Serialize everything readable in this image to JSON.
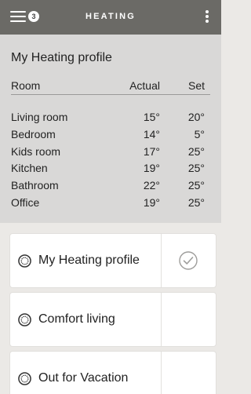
{
  "header": {
    "title": "HEATING",
    "badge_count": "3",
    "menu_icon": "hamburger-menu-icon",
    "more_icon": "more-vertical-icon"
  },
  "summary": {
    "profile_title": "My Heating profile",
    "columns": {
      "room": "Room",
      "actual": "Actual",
      "set": "Set"
    },
    "rows": [
      {
        "room": "Living room",
        "actual": "15",
        "set": "20"
      },
      {
        "room": "Bedroom",
        "actual": "14",
        "set": "5"
      },
      {
        "room": "Kids room",
        "actual": "17",
        "set": "25"
      },
      {
        "room": "Kitchen",
        "actual": "19",
        "set": "25"
      },
      {
        "room": "Bathroom",
        "actual": "22",
        "set": "25"
      },
      {
        "room": "Office",
        "actual": "19",
        "set": "25"
      }
    ],
    "degree_symbol": "°"
  },
  "profiles": [
    {
      "label": "My Heating profile",
      "selected": true
    },
    {
      "label": "Comfort living",
      "selected": false
    },
    {
      "label": "Out for Vacation",
      "selected": false
    }
  ],
  "colors": {
    "header_bg": "#6b6a66",
    "summary_bg": "#d9d8d7",
    "page_bg": "#ebe9e6",
    "card_bg": "#ffffff"
  }
}
